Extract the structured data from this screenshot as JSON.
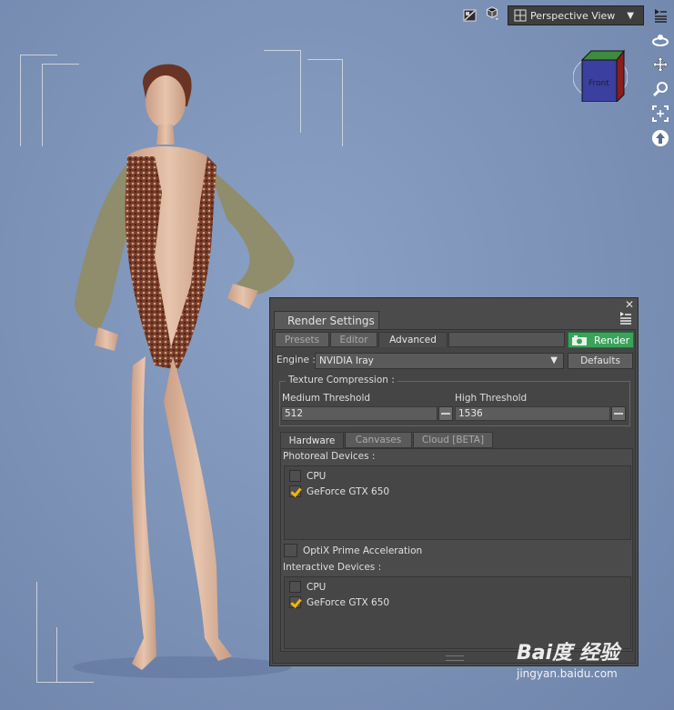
{
  "toolbar": {
    "view_select_label": "Perspective View",
    "view_cube_label": "Front"
  },
  "panel": {
    "title": "Render Settings",
    "tabs": [
      "Presets",
      "Editor",
      "Advanced"
    ],
    "active_tab": "Advanced",
    "render_label": "Render",
    "engine_label": "Engine :",
    "engine_value": "NVIDIA Iray",
    "defaults_label": "Defaults",
    "texture_compression": {
      "legend": "Texture Compression :",
      "medium_label": "Medium Threshold",
      "medium_value": "512",
      "high_label": "High Threshold",
      "high_value": "1536"
    },
    "hw_tabs": [
      "Hardware",
      "Canvases",
      "Cloud [BETA]"
    ],
    "active_hw_tab": "Hardware",
    "photoreal": {
      "label": "Photoreal Devices :",
      "devices": [
        {
          "name": "CPU",
          "checked": false
        },
        {
          "name": "GeForce GTX 650",
          "checked": true
        }
      ]
    },
    "optix": {
      "label": "OptiX Prime Acceleration",
      "checked": false
    },
    "interactive": {
      "label": "Interactive Devices :",
      "devices": [
        {
          "name": "CPU",
          "checked": false
        },
        {
          "name": "GeForce GTX 650",
          "checked": true
        }
      ]
    }
  },
  "watermark": {
    "main": "Bai度 经验",
    "sub": "jingyan.baidu.com"
  },
  "colors": {
    "viewport_bg": "#7d92b6",
    "panel_bg": "#4b4b4b",
    "render_button": "#3aa35b",
    "checkmark": "#f2b600"
  }
}
